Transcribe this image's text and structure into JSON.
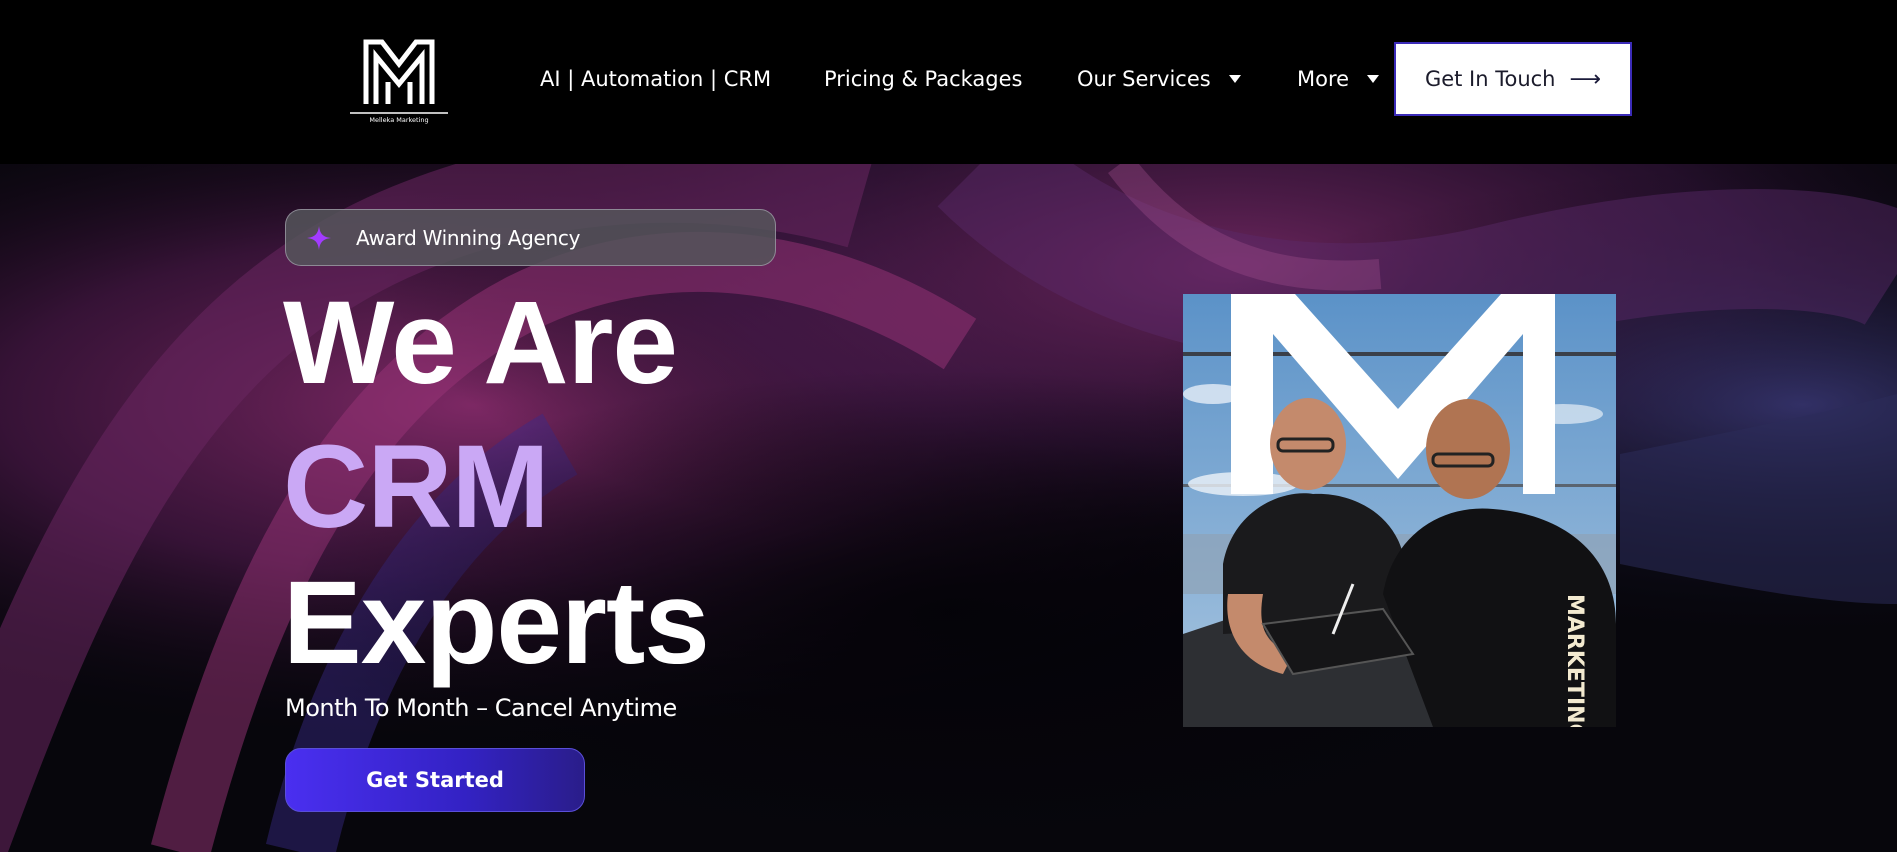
{
  "header": {
    "logo_name": "Melleka Marketing",
    "nav": [
      {
        "label": "AI | Automation | CRM",
        "has_dropdown": false
      },
      {
        "label": "Pricing & Packages",
        "has_dropdown": false
      },
      {
        "label": "Our Services",
        "has_dropdown": true
      },
      {
        "label": "More",
        "has_dropdown": true
      }
    ],
    "cta_label": "Get In Touch",
    "cta_icon": "arrow-right-icon"
  },
  "hero": {
    "badge": {
      "icon": "sparkle-icon",
      "label": "Award Winning Agency"
    },
    "headline": {
      "line1": "We Are",
      "line2": "CRM",
      "line3": "Experts"
    },
    "subline": "Month To Month – Cancel Anytime",
    "cta_label": "Get Started",
    "photo": {
      "icon": "team-photo"
    }
  },
  "colors": {
    "accent_purple": "#caa8f5",
    "button_blue": "#4a2ff0",
    "header_bg": "#000000",
    "badge_star": "#a33bff"
  }
}
